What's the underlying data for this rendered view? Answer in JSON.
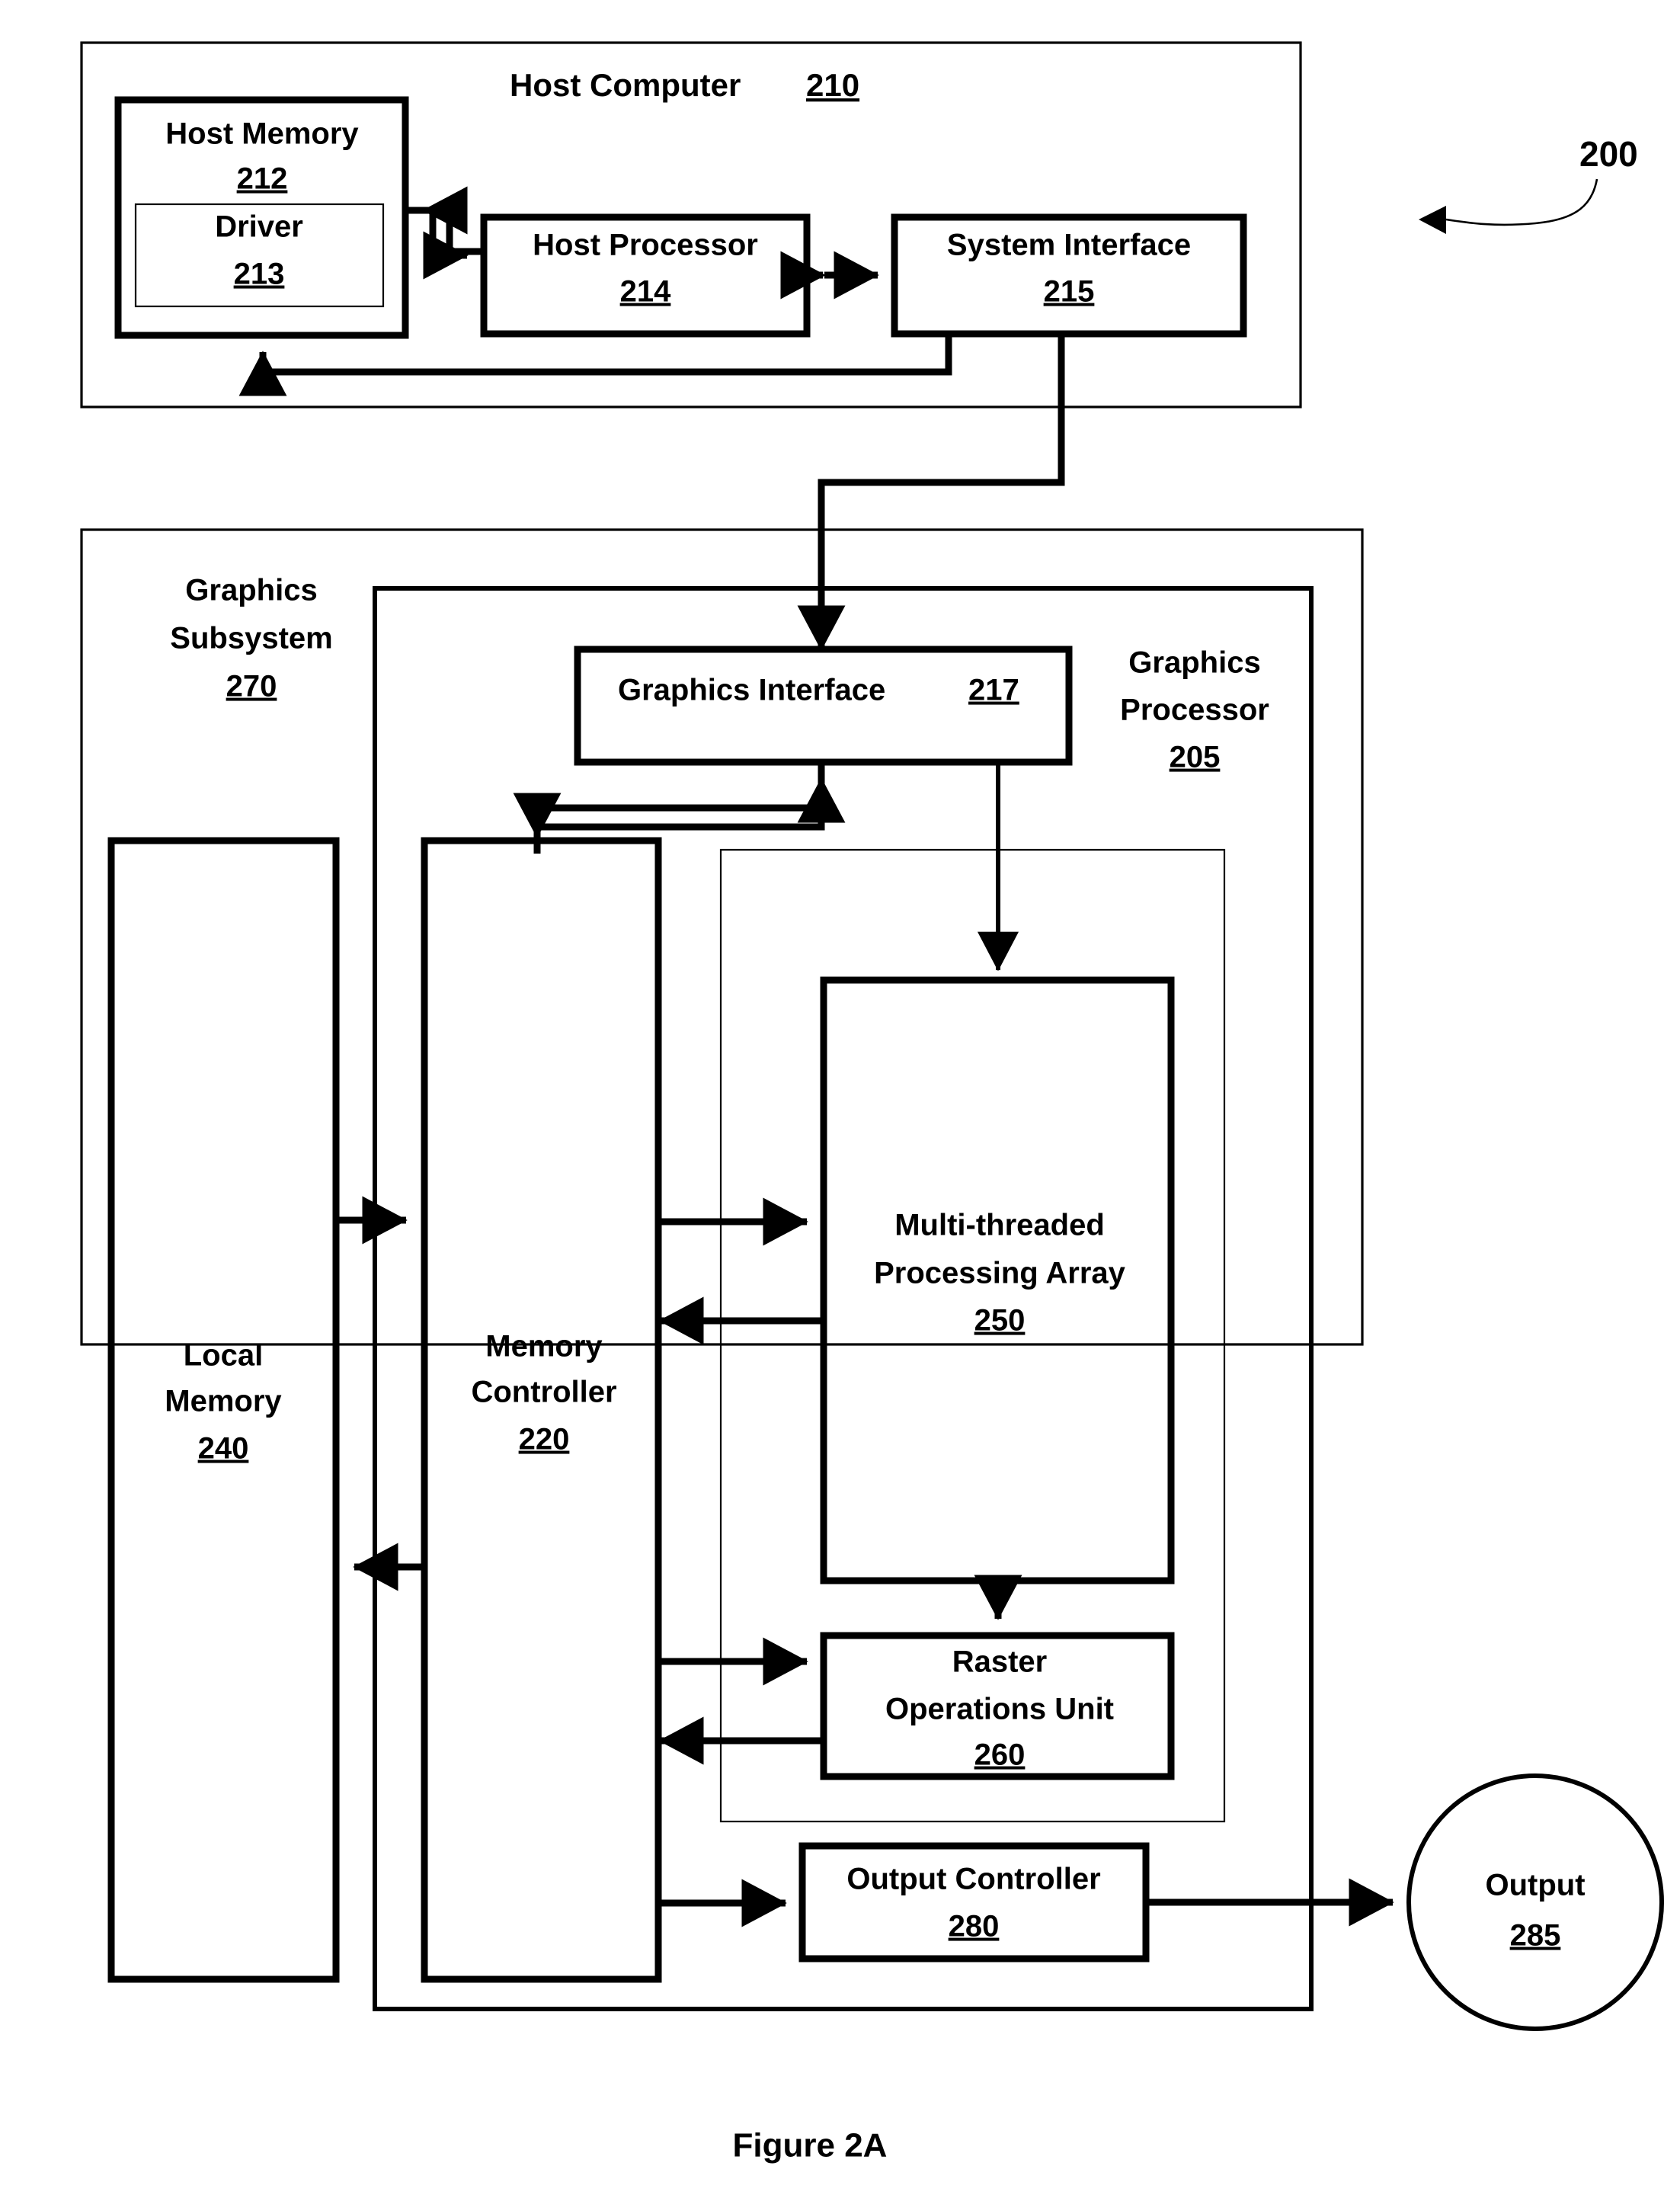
{
  "figure": {
    "caption": "Figure 2A",
    "system_ref": "200"
  },
  "host_computer": {
    "title": "Host Computer",
    "ref": "210",
    "host_memory": {
      "title": "Host Memory",
      "ref": "212",
      "driver": {
        "title": "Driver",
        "ref": "213"
      }
    },
    "host_processor": {
      "title": "Host Processor",
      "ref": "214"
    },
    "system_interface": {
      "title": "System Interface",
      "ref": "215"
    }
  },
  "graphics_subsystem": {
    "title_line1": "Graphics",
    "title_line2": "Subsystem",
    "ref": "270",
    "graphics_processor": {
      "title_line1": "Graphics",
      "title_line2": "Processor",
      "ref": "205"
    },
    "graphics_interface": {
      "title": "Graphics Interface",
      "ref": "217"
    },
    "local_memory": {
      "title_line1": "Local",
      "title_line2": "Memory",
      "ref": "240"
    },
    "memory_controller": {
      "title_line1": "Memory",
      "title_line2": "Controller",
      "ref": "220"
    },
    "multi_threaded_processing_array": {
      "title_line1": "Multi-threaded",
      "title_line2": "Processing Array",
      "ref": "250"
    },
    "raster_operations_unit": {
      "title_line1": "Raster",
      "title_line2": "Operations Unit",
      "ref": "260"
    },
    "output_controller": {
      "title": "Output Controller",
      "ref": "280"
    }
  },
  "output": {
    "title": "Output",
    "ref": "285"
  },
  "colors": {
    "ink": "#000000",
    "paper": "#ffffff"
  }
}
